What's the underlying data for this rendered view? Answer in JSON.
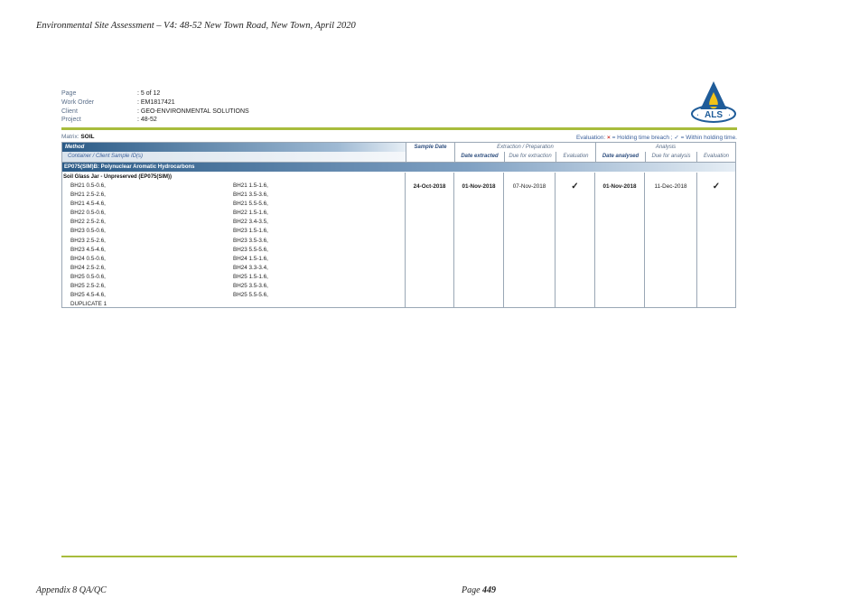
{
  "header": {
    "title": "Environmental Site Assessment – V4: 48-52 New Town Road, New Town, April 2020"
  },
  "meta": [
    {
      "key": "Page",
      "value": ": 5 of 12"
    },
    {
      "key": "Work Order",
      "value": ": EM1817421"
    },
    {
      "key": "Client",
      "value": ": GEO-ENVIRONMENTAL SOLUTIONS"
    },
    {
      "key": "Project",
      "value": ": 48-52"
    }
  ],
  "logo": {
    "text": "ALS",
    "colors": {
      "blue": "#1f5c99",
      "yellow": "#f2c318"
    }
  },
  "matrix": {
    "label": "Matrix:",
    "value": "SOIL"
  },
  "evaluation_key": {
    "prefix": "Evaluation:",
    "breach_symbol": "×",
    "breach_text": "= Holding time breach ;",
    "within_symbol": "✓",
    "within_text": "= Within holding time."
  },
  "table": {
    "method_header": "Method",
    "container_header": "Container / Client Sample ID(s)",
    "sample_date_header": "Sample Date",
    "extraction_group": "Extraction / Preparation",
    "analysis_group": "Analysis",
    "date_extracted_header": "Date extracted",
    "due_extraction_header": "Due for extraction",
    "evaluation_header": "Evaluation",
    "date_analysed_header": "Date analysed",
    "due_analysis_header": "Due for analysis",
    "evaluation2_header": "Evaluation",
    "section_title": "EP075(SIM)B: Polynuclear Aromatic Hydrocarbons",
    "container_title": "Soil Glass Jar - Unpreserved (EP075(SIM))",
    "sample_ids": [
      [
        "BH21 0.5-0.6,",
        "BH21 1.5-1.6,"
      ],
      [
        "BH21 2.5-2.6,",
        "BH21 3.5-3.6,"
      ],
      [
        "BH21 4.5-4.6,",
        "BH21 5.5-5.6,"
      ],
      [
        "BH22 0.5-0.6,",
        "BH22 1.5-1.6,"
      ],
      [
        "BH22 2.5-2.6,",
        "BH22 3.4-3.5,"
      ],
      [
        "BH23 0.5-0.6,",
        "BH23 1.5-1.6,"
      ],
      [
        "BH23 2.5-2.6,",
        "BH23 3.5-3.6,"
      ],
      [
        "BH23 4.5-4.6,",
        "BH23 5.5-5.6,"
      ],
      [
        "BH24 0.5-0.6,",
        "BH24 1.5-1.6,"
      ],
      [
        "BH24 2.5-2.6,",
        "BH24 3.3-3.4,"
      ],
      [
        "BH25 0.5-0.6,",
        "BH25 1.5-1.6,"
      ],
      [
        "BH25 2.5-2.6,",
        "BH25 3.5-3.6,"
      ],
      [
        "BH25 4.5-4.6,",
        "BH25 5.5-5.6,"
      ],
      [
        "DUPLICATE 1",
        ""
      ]
    ],
    "sample_date": "24-Oct-2018",
    "date_extracted": "01-Nov-2018",
    "due_extraction": "07-Nov-2018",
    "evaluation_extraction": "✓",
    "date_analysed": "01-Nov-2018",
    "due_analysis": "11-Dec-2018",
    "evaluation_analysis": "✓"
  },
  "footer": {
    "left": "Appendix 8 QA/QC",
    "page_label": "Page",
    "page_number": "449"
  }
}
